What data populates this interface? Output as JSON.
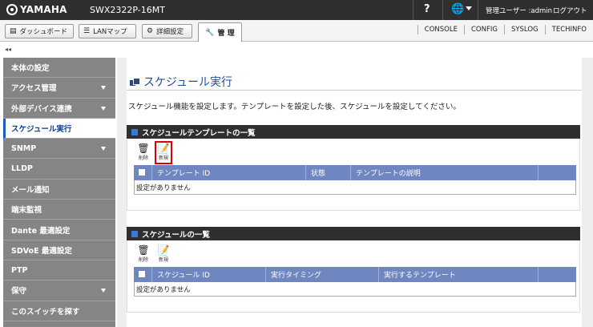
{
  "topbar": {
    "brand": "YAMAHA",
    "model": "SWX2322P-16MT",
    "help_icon": "?",
    "language_icon": "globe-icon",
    "user_label": "管理ユーザー :admin",
    "logout": "ログアウト"
  },
  "navbar": {
    "dashboard": "ダッシュボード",
    "lanmap": "LANマップ",
    "detail_settings": "詳細設定",
    "management": "管 理",
    "links": [
      "CONSOLE",
      "CONFIG",
      "SYSLOG",
      "TECHINFO"
    ]
  },
  "collapse_icon": "◂◂",
  "sidebar": {
    "items": [
      {
        "label": "本体の設定",
        "expandable": false,
        "active": false
      },
      {
        "label": "アクセス管理",
        "expandable": true,
        "active": false
      },
      {
        "label": "外部デバイス連携",
        "expandable": true,
        "active": false
      },
      {
        "label": "スケジュール実行",
        "expandable": false,
        "active": true
      },
      {
        "label": "SNMP",
        "expandable": true,
        "active": false
      },
      {
        "label": "LLDP",
        "expandable": false,
        "active": false
      },
      {
        "label": "メール通知",
        "expandable": false,
        "active": false
      },
      {
        "label": "端末監視",
        "expandable": false,
        "active": false
      },
      {
        "label": "Dante 最適設定",
        "expandable": false,
        "active": false
      },
      {
        "label": "SDVoE 最適設定",
        "expandable": false,
        "active": false
      },
      {
        "label": "PTP",
        "expandable": false,
        "active": false
      },
      {
        "label": "保守",
        "expandable": true,
        "active": false
      },
      {
        "label": "このスイッチを探す",
        "expandable": false,
        "active": false
      }
    ]
  },
  "main": {
    "title": "スケジュール実行",
    "description": "スケジュール機能を設定します。テンプレートを設定した後、スケジュールを設定してください。",
    "template_section": {
      "heading": "スケジュールテンプレートの一覧",
      "delete_label": "削除",
      "new_label": "新規",
      "columns": [
        "テンプレート ID",
        "状態",
        "テンプレートの説明"
      ],
      "empty_text": "設定がありません"
    },
    "schedule_section": {
      "heading": "スケジュールの一覧",
      "delete_label": "削除",
      "new_label": "新規",
      "columns": [
        "スケジュール ID",
        "実行タイミング",
        "実行するテンプレート"
      ],
      "empty_text": "設定がありません"
    }
  },
  "colors": {
    "topbar": "#2f2f2f",
    "sidebar": "#858585",
    "table_header": "#6f86c0",
    "title": "#1d4f9c",
    "highlight": "#e00000"
  }
}
